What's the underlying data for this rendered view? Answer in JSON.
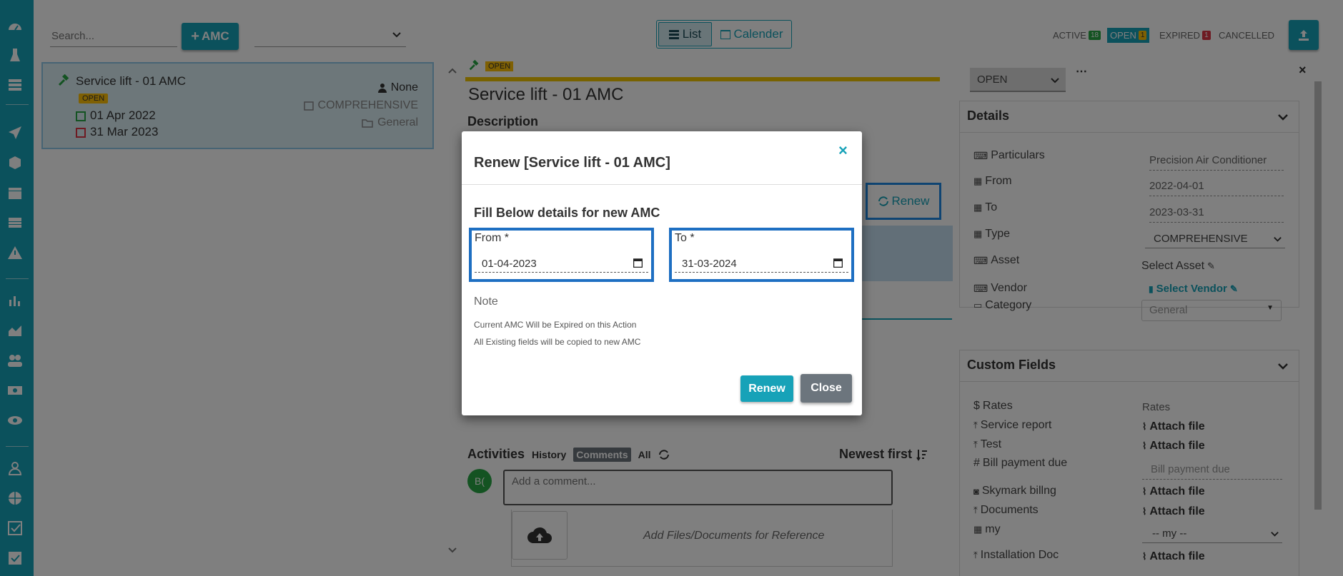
{
  "colors": {
    "accent": "#17a2b8",
    "open_badge": "#ffc107",
    "active_badge": "#28a745",
    "expired_badge": "#dc3545",
    "highlight_border": "#1e88e5"
  },
  "sidebar": {
    "icons": [
      "dashboard-icon",
      "broom-icon",
      "list-icon",
      "send-icon",
      "box-icon",
      "calendar-icon",
      "table-icon",
      "warning-icon",
      "bar-chart-icon",
      "area-chart-icon",
      "users-icon",
      "money-icon",
      "eye-icon",
      "user-icon",
      "globe-icon",
      "checkbox-icon",
      "check-square-icon"
    ]
  },
  "topbar": {
    "search_placeholder": "Search...",
    "add_amc_label": "AMC",
    "view_list": "List",
    "view_calendar": "Calender",
    "status": [
      {
        "label": "ACTIVE",
        "count": "18",
        "color": "#28a745"
      },
      {
        "label": "OPEN",
        "count": "1",
        "color": "#ffc107"
      },
      {
        "label": "EXPIRED",
        "count": "1",
        "color": "#dc3545"
      },
      {
        "label": "CANCELLED",
        "count": "",
        "color": ""
      }
    ]
  },
  "list_card": {
    "title": "Service lift - 01 AMC",
    "badge": "OPEN",
    "from_date": "01 Apr 2022",
    "to_date": "31 Mar 2023",
    "assignee": "None",
    "type": "COMPREHENSIVE",
    "category": "General"
  },
  "detail": {
    "badge": "OPEN",
    "title": "Service lift - 01 AMC",
    "description_label": "Description",
    "renew_label": "Renew",
    "activities_label": "Activities",
    "tabs": [
      "History",
      "Comments",
      "All"
    ],
    "sort_label": "Newest first",
    "avatar_initials": "B(",
    "comment_placeholder": "Add a comment...",
    "attach_text": "Add Files/Documents for Reference"
  },
  "right_panel": {
    "status_select": "OPEN",
    "details_title": "Details",
    "details": {
      "particulars_label": "Particulars",
      "particulars_value": "Precision Air Conditioner",
      "from_label": "From",
      "from_value": "2022-04-01",
      "to_label": "To",
      "to_value": "2023-03-31",
      "type_label": "Type",
      "type_value": "COMPREHENSIVE",
      "asset_label": "Asset",
      "asset_value": "Select Asset",
      "vendor_label": "Vendor",
      "vendor_value": "Select Vendor",
      "category_label": "Category",
      "category_value": "General"
    },
    "custom_title": "Custom Fields",
    "custom": {
      "rates_label": "Rates",
      "rates_value": "Rates",
      "service_report_label": "Service report",
      "test_label": "Test",
      "bill_label": "Bill payment due",
      "bill_value": "Bill payment due",
      "skymark_label": "Skymark billng",
      "documents_label": "Documents",
      "my_label": "my",
      "my_value": "-- my --",
      "installation_label": "Installation Doc",
      "attach_label": "Attach file"
    }
  },
  "modal": {
    "title": "Renew [Service lift - 01 AMC]",
    "subtitle": "Fill Below details for new AMC",
    "from_label": "From *",
    "from_value": "01-04-2023",
    "to_label": "To *",
    "to_value": "31-03-2024",
    "note_label": "Note",
    "note_1": "Current AMC Will be Expired on this Action",
    "note_2": "All Existing fields will be copied to new AMC",
    "renew_button": "Renew",
    "close_button": "Close"
  }
}
